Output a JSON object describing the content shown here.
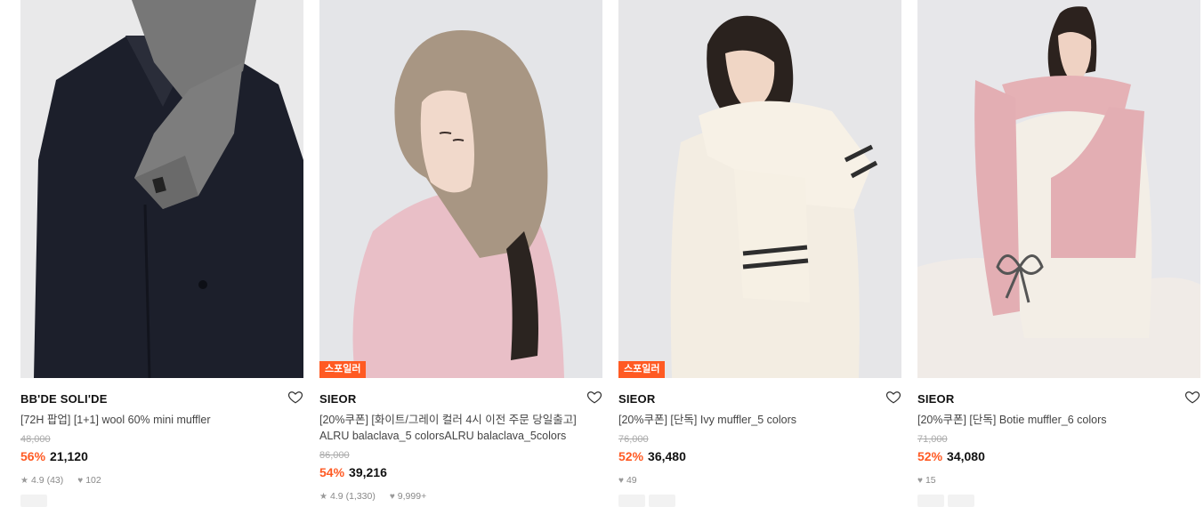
{
  "products": [
    {
      "brand": "BB'DE SOLI'DE",
      "title": "[72H 팝업] [1+1] wool 60% mini muffler",
      "title2": "",
      "original_price": "48,000",
      "discount": "56%",
      "price": "21,120",
      "rating": "4.9",
      "reviews": "(43)",
      "likes": "102",
      "badge": ""
    },
    {
      "brand": "SIEOR",
      "title": "[20%쿠폰] [화이트/그레이 컬러 4시 이전 주문 당일출고]",
      "title2": "ALRU balaclava_5 colorsALRU balaclava_5colors",
      "original_price": "86,000",
      "discount": "54%",
      "price": "39,216",
      "rating": "4.9",
      "reviews": "(1,330)",
      "likes": "9,999+",
      "badge": "스포일러"
    },
    {
      "brand": "SIEOR",
      "title": "[20%쿠폰] [단독] Ivy muffler_5 colors",
      "title2": "",
      "original_price": "76,000",
      "discount": "52%",
      "price": "36,480",
      "rating": "",
      "reviews": "",
      "likes": "49",
      "badge": "스포일러"
    },
    {
      "brand": "SIEOR",
      "title": "[20%쿠폰] [단독] Botie muffler_6 colors",
      "title2": "",
      "original_price": "71,000",
      "discount": "52%",
      "price": "34,080",
      "rating": "",
      "reviews": "",
      "likes": "15",
      "badge": ""
    }
  ],
  "icons": {
    "heart": "heart-outline-icon",
    "star": "star-icon",
    "like": "heart-filled-icon"
  },
  "colors": {
    "accent": "#ff5a23",
    "text": "#111111",
    "muted": "#888888"
  }
}
